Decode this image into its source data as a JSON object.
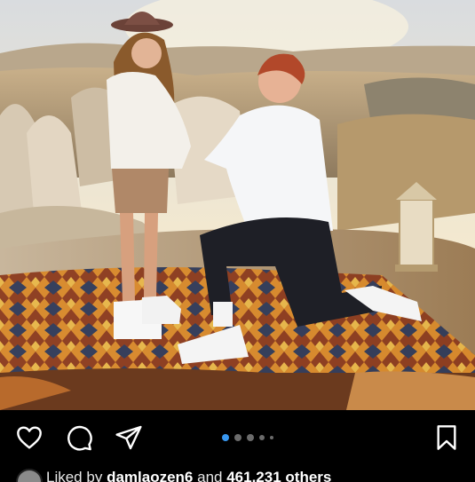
{
  "post": {
    "image_alt": "",
    "carousel": {
      "total_dots": 5,
      "active_index": 0
    }
  },
  "actions": {
    "like_icon": "heart-icon",
    "comment_icon": "comment-icon",
    "share_icon": "send-icon",
    "save_icon": "bookmark-icon"
  },
  "likes": {
    "prefix": "Liked by",
    "username": "damlaozen6",
    "connector": "and",
    "count": "461,231 others"
  },
  "colors": {
    "background": "#000000",
    "active_dot": "#3897f0",
    "inactive_dot": "#6b6b6b"
  }
}
